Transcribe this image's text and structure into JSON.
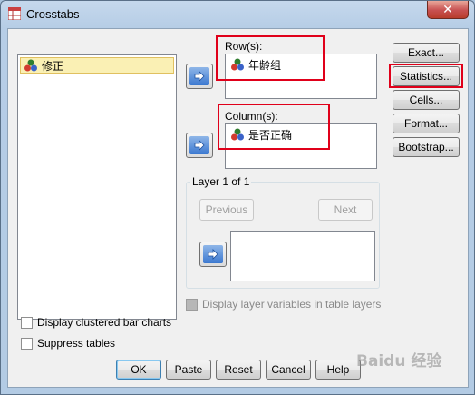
{
  "window": {
    "title": "Crosstabs",
    "close_label": "✕"
  },
  "source_list": {
    "items": [
      {
        "label": "修正"
      }
    ]
  },
  "rows": {
    "label": "Row(s):",
    "items": [
      {
        "label": "年龄组"
      }
    ]
  },
  "columns": {
    "label": "Column(s):",
    "items": [
      {
        "label": "是否正确"
      }
    ]
  },
  "layer": {
    "title": "Layer 1 of 1",
    "previous_label": "Previous",
    "next_label": "Next"
  },
  "side_buttons": {
    "exact": "Exact...",
    "statistics": "Statistics...",
    "cells": "Cells...",
    "format": "Format...",
    "bootstrap": "Bootstrap..."
  },
  "options": {
    "display_layer_variables": "Display layer variables in table layers",
    "display_clustered": "Display clustered bar charts",
    "suppress_tables": "Suppress tables"
  },
  "footer_buttons": {
    "ok": "OK",
    "paste": "Paste",
    "reset": "Reset",
    "cancel": "Cancel",
    "help": "Help"
  },
  "watermark": "Baidu 经验",
  "colors": {
    "highlight": "#e0001a",
    "selected_bg": "#faf0b4"
  }
}
